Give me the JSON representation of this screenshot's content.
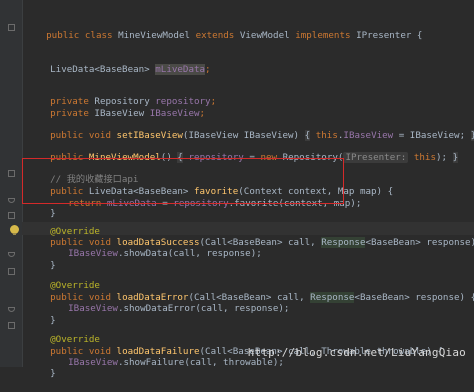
{
  "code": {
    "class_decl": {
      "kw1": "public",
      "kw2": "class",
      "name": "MineViewModel",
      "kw3": "extends",
      "parent": "ViewModel",
      "kw4": "implements",
      "iface": "IPresenter {"
    },
    "field1": {
      "type": "LiveData<BaseBean> ",
      "name": "mLiveData",
      "end": ";"
    },
    "field2": {
      "mod": "private",
      "type": " Repository ",
      "name": "repository",
      "end": ";"
    },
    "field3": {
      "mod": "private",
      "type": " IBaseView ",
      "name": "IBaseView",
      "end": ";"
    },
    "setter": {
      "mods": "public void ",
      "name": "setIBaseView",
      "params": "(IBaseView IBaseView) ",
      "brace_open": "{",
      "this_kw": "this",
      "dot": ".",
      "fld": "IBaseView",
      "assign": " = IBaseView; ",
      "brace_close": "}"
    },
    "ctor": {
      "mod": "public ",
      "name": "MineViewModel",
      "paren": "() ",
      "brace_open": "{",
      "fld": "repository",
      "assign": " = ",
      "new_kw": "new",
      "cls": " Repository(",
      "hint": "IPresenter:",
      "this_kw": "this",
      "end": ");",
      "brace_close": "}"
    },
    "comment": "// 我的收藏接口api",
    "favorite": {
      "mods": "public ",
      "type": "LiveData<BaseBean> ",
      "name": "favorite",
      "params": "(Context context, Map map) {"
    },
    "favorite_body": {
      "kw": "return ",
      "fld1": "mLiveData",
      "assign": " = ",
      "fld2": "repository",
      "rest": ".favorite(context, map);"
    },
    "brace": "}",
    "override": "@Override",
    "success": {
      "mods": "public void ",
      "name": "loadDataSuccess",
      "p1": "(Call<BaseBean> call, ",
      "resp": "Response",
      "p2": "<BaseBean> response) {"
    },
    "success_body": {
      "fld": "IBaseView",
      "call": ".showData(call, response);"
    },
    "error": {
      "mods": "public void ",
      "name": "loadDataError",
      "p1": "(Call<BaseBean> call, ",
      "resp": "Response",
      "p2": "<BaseBean> response) {"
    },
    "error_body": {
      "fld": "IBaseView",
      "call": ".showDataError(call, response);"
    },
    "failure": {
      "mods": "public void ",
      "name": "loadDataFailure",
      "p1": "(Call<BaseBean> call, Throwable throwable) {"
    },
    "failure_body": {
      "fld": "IBaseView",
      "call": ".showFailure(call, throwable);"
    }
  },
  "watermark": "http://blog.csdn.net/LiuYangQiao"
}
